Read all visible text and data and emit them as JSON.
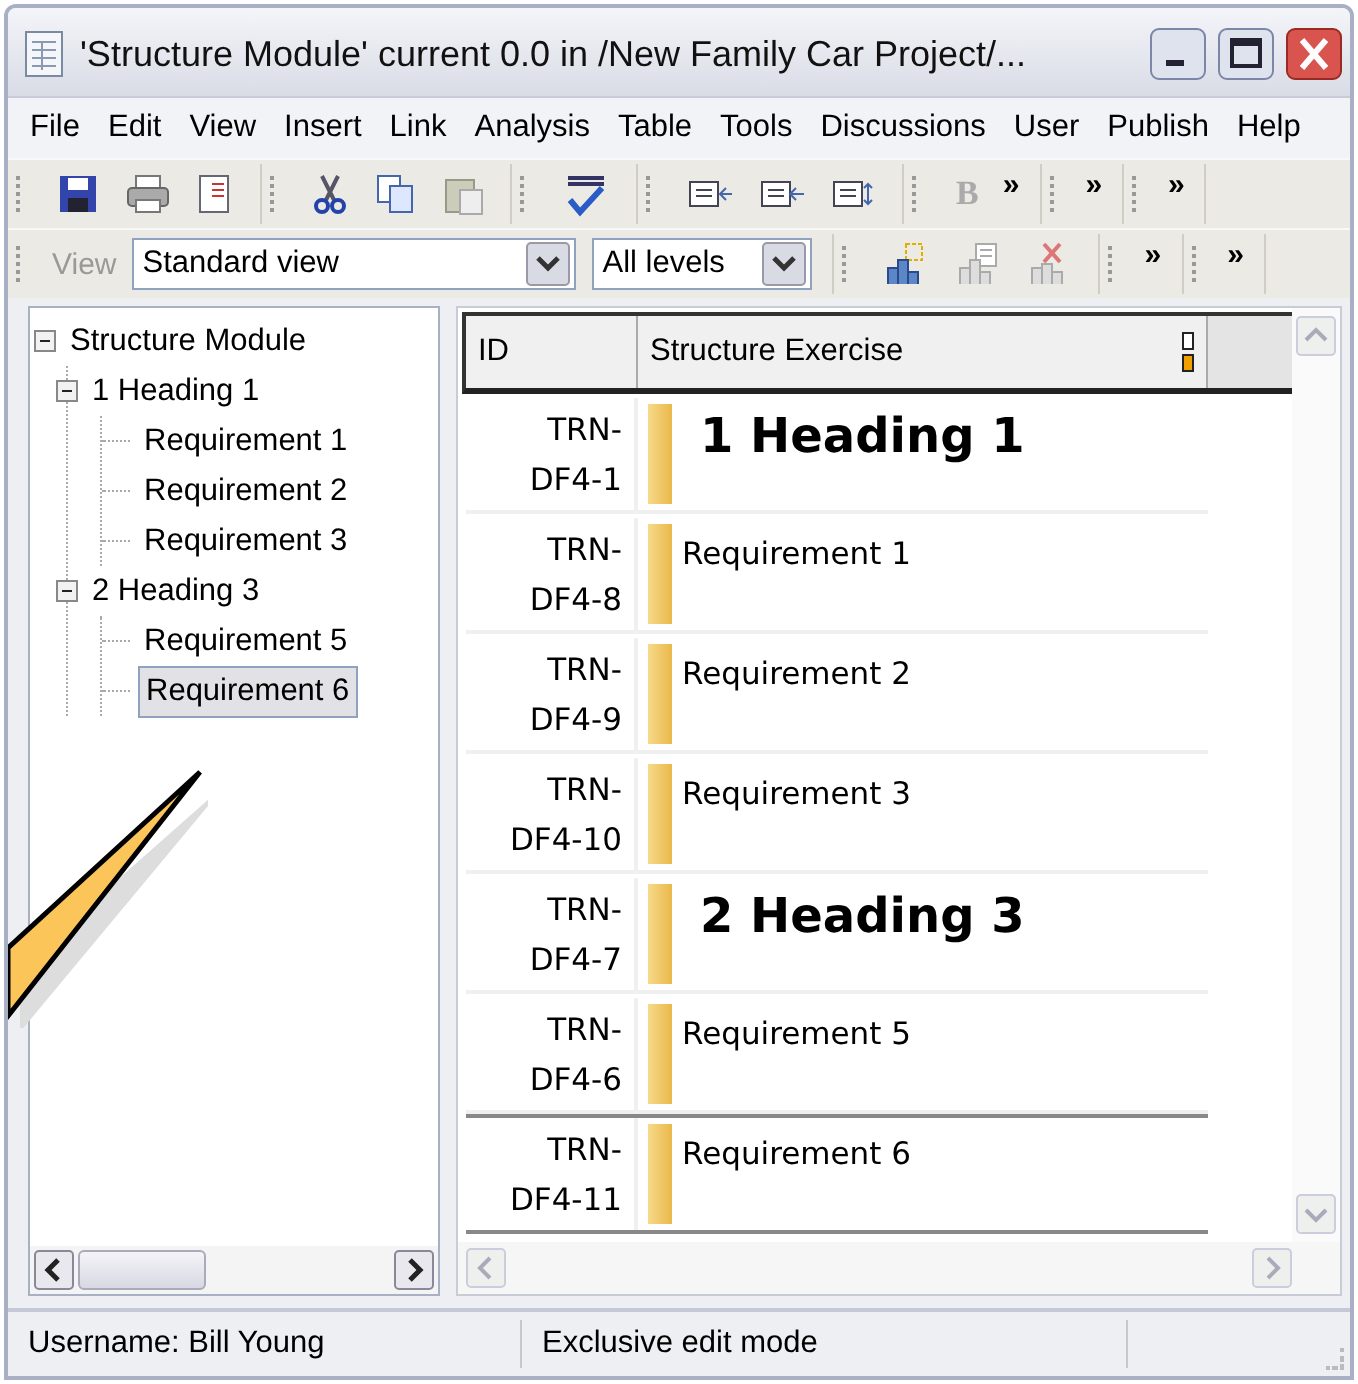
{
  "window": {
    "title": "'Structure Module' current 0.0 in /New Family Car Project/..."
  },
  "menu": [
    {
      "label": "File"
    },
    {
      "label": "Edit"
    },
    {
      "label": "View"
    },
    {
      "label": "Insert"
    },
    {
      "label": "Link"
    },
    {
      "label": "Analysis"
    },
    {
      "label": "Table"
    },
    {
      "label": "Tools"
    },
    {
      "label": "Discussions"
    },
    {
      "label": "User"
    },
    {
      "label": "Publish"
    },
    {
      "label": "Help"
    }
  ],
  "toolbar_1": {
    "bold_button": {
      "label": "B",
      "disabled": true
    },
    "chevrons": [
      "»",
      "»",
      "»"
    ]
  },
  "toolbar_2": {
    "view_label": "View",
    "view_select": "Standard view",
    "level_select": "All levels",
    "chevrons": [
      "»",
      "»"
    ]
  },
  "tree": {
    "items": [
      {
        "label": "Structure Module",
        "expanded": true,
        "selected": false,
        "children": [
          {
            "label": "1 Heading 1",
            "expanded": true,
            "selected": false,
            "children": [
              {
                "label": "Requirement 1",
                "selected": false
              },
              {
                "label": "Requirement 2",
                "selected": false
              },
              {
                "label": "Requirement 3",
                "selected": false
              }
            ]
          },
          {
            "label": "2 Heading 3",
            "expanded": true,
            "selected": false,
            "children": [
              {
                "label": "Requirement 5",
                "selected": false
              },
              {
                "label": "Requirement 6",
                "selected": true
              }
            ]
          }
        ]
      }
    ]
  },
  "table": {
    "columns": [
      "ID",
      "Structure Exercise"
    ],
    "rows": [
      {
        "id": "TRN-DF4-1",
        "text": "1 Heading 1",
        "kind": "heading",
        "selected": false
      },
      {
        "id": "TRN-DF4-8",
        "text": "Requirement 1",
        "kind": "requirement",
        "selected": false
      },
      {
        "id": "TRN-DF4-9",
        "text": "Requirement 2",
        "kind": "requirement",
        "selected": false
      },
      {
        "id": "TRN-DF4-10",
        "text": "Requirement 3",
        "kind": "requirement",
        "selected": false
      },
      {
        "id": "TRN-DF4-7",
        "text": "2 Heading 3",
        "kind": "heading",
        "selected": false
      },
      {
        "id": "TRN-DF4-6",
        "text": "Requirement 5",
        "kind": "requirement",
        "selected": false
      },
      {
        "id": "TRN-DF4-11",
        "text": "Requirement 6",
        "kind": "requirement",
        "selected": true
      }
    ]
  },
  "status_bar": [
    "Username: Bill Young",
    "Exclusive edit mode"
  ]
}
